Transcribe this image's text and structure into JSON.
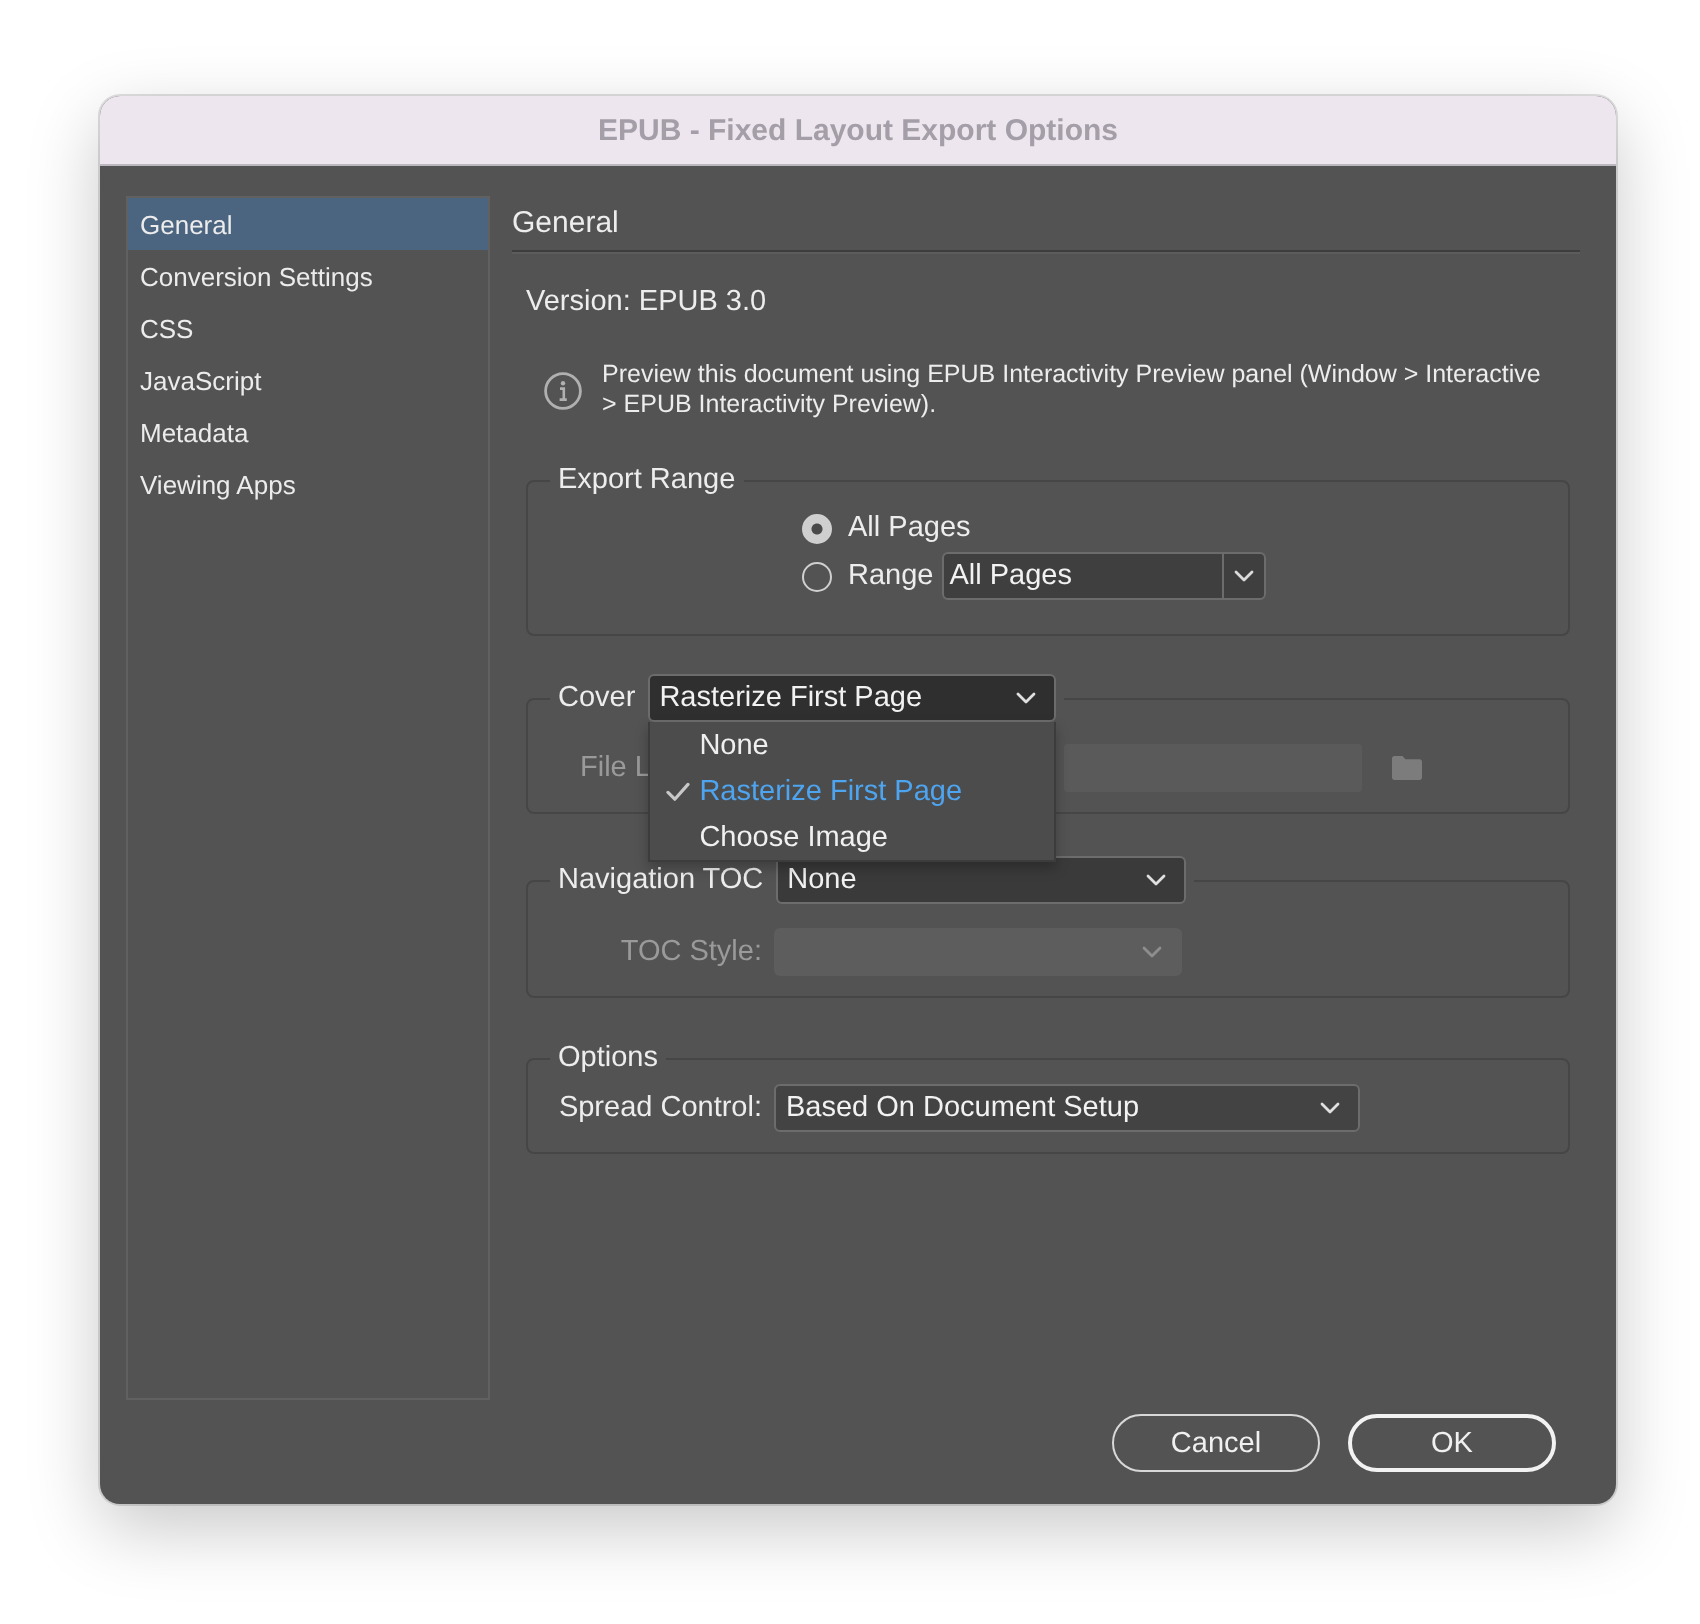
{
  "window": {
    "title": "EPUB - Fixed Layout Export Options"
  },
  "sidebar": {
    "items": [
      {
        "label": "General",
        "selected": true
      },
      {
        "label": "Conversion Settings",
        "selected": false
      },
      {
        "label": "CSS",
        "selected": false
      },
      {
        "label": "JavaScript",
        "selected": false
      },
      {
        "label": "Metadata",
        "selected": false
      },
      {
        "label": "Viewing Apps",
        "selected": false
      }
    ]
  },
  "general": {
    "heading": "General",
    "version": "Version: EPUB 3.0",
    "info": "Preview this document using EPUB Interactivity Preview panel (Window > Interactive > EPUB Interactivity Preview)."
  },
  "export_range": {
    "legend": "Export Range",
    "options": [
      {
        "label": "All Pages",
        "selected": true
      },
      {
        "label": "Range",
        "selected": false
      }
    ],
    "range_select": {
      "value": "All Pages"
    }
  },
  "cover": {
    "label": "Cover",
    "select": {
      "value": "Rasterize First Page",
      "expanded": true
    },
    "menu": [
      {
        "label": "None",
        "selected": false
      },
      {
        "label": "Rasterize First Page",
        "selected": true
      },
      {
        "label": "Choose Image",
        "selected": false
      }
    ],
    "file_location": {
      "label": "File L",
      "disabled": true
    }
  },
  "navigation_toc": {
    "label": "Navigation TOC",
    "select": {
      "value": "None"
    },
    "toc_style": {
      "label": "TOC Style:",
      "disabled": true
    }
  },
  "options": {
    "legend": "Options",
    "spread_control": {
      "label": "Spread Control:",
      "value": "Based On Document Setup"
    }
  },
  "buttons": [
    {
      "label": "Cancel",
      "default": false
    },
    {
      "label": "OK",
      "default": true
    }
  ]
}
